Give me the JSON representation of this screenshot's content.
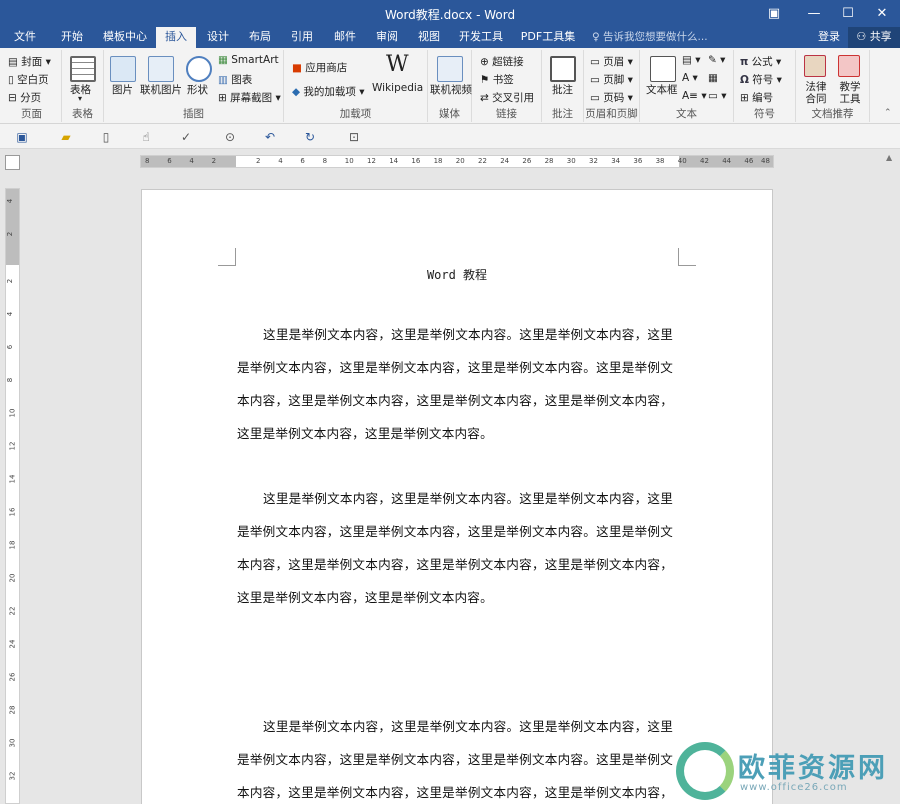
{
  "window": {
    "title": "Word教程.docx - Word",
    "controls": {
      "ribbon_options": "▣",
      "minimize": "—",
      "maximize": "☐",
      "close": "✕"
    }
  },
  "tabs": [
    "文件",
    "开始",
    "模板中心",
    "插入",
    "设计",
    "布局",
    "引用",
    "邮件",
    "审阅",
    "视图",
    "开发工具",
    "PDF工具集"
  ],
  "active_tab": "插入",
  "tell_me": "告诉我您想要做什么...",
  "account": {
    "login": "登录",
    "share": "共享"
  },
  "ribbon": {
    "pages": {
      "label": "页面",
      "cover": "封面",
      "blank": "空白页",
      "break": "分页"
    },
    "tables": {
      "label": "表格",
      "table": "表格"
    },
    "illustrations": {
      "label": "插图",
      "picture": "图片",
      "online_picture": "联机图片",
      "shapes": "形状",
      "smartart": "SmartArt",
      "chart": "图表",
      "screenshot": "屏幕截图"
    },
    "addins": {
      "label": "加载项",
      "store": "应用商店",
      "my_addins": "我的加载项",
      "wikipedia": "Wikipedia"
    },
    "media": {
      "label": "媒体",
      "online_video": "联机视频"
    },
    "links": {
      "label": "链接",
      "hyperlink": "超链接",
      "bookmark": "书签",
      "cross_ref": "交叉引用"
    },
    "comments": {
      "label": "批注",
      "comment": "批注"
    },
    "header_footer": {
      "label": "页眉和页脚",
      "header": "页眉",
      "footer": "页脚",
      "page_number": "页码"
    },
    "text": {
      "label": "文本",
      "textbox": "文本框"
    },
    "symbols": {
      "label": "符号",
      "equation": "公式",
      "symbol": "符号",
      "number": "编号"
    },
    "recommend": {
      "label": "文档推荐",
      "law": "法律合同",
      "teach": "教学工具"
    }
  },
  "ruler": {
    "h_ticks": [
      "8",
      "6",
      "4",
      "2",
      "2",
      "4",
      "6",
      "8",
      "10",
      "12",
      "14",
      "16",
      "18",
      "20",
      "22",
      "24",
      "26",
      "28",
      "30",
      "32",
      "34",
      "36",
      "38",
      "40",
      "42",
      "44",
      "46",
      "48"
    ],
    "v_ticks": [
      "4",
      "2",
      "2",
      "4",
      "6",
      "8",
      "10",
      "12",
      "14",
      "16",
      "18",
      "20",
      "22",
      "24",
      "26",
      "28",
      "30",
      "32"
    ]
  },
  "document": {
    "title": "Word 教程",
    "paragraphs": [
      "这里是举例文本内容，这里是举例文本内容。这里是举例文本内容，这里是举例文本内容，这里是举例文本内容，这里是举例文本内容。这里是举例文本内容，这里是举例文本内容，这里是举例文本内容，这里是举例文本内容，这里是举例文本内容，这里是举例文本内容。",
      "这里是举例文本内容，这里是举例文本内容。这里是举例文本内容，这里是举例文本内容，这里是举例文本内容，这里是举例文本内容。这里是举例文本内容，这里是举例文本内容，这里是举例文本内容，这里是举例文本内容，这里是举例文本内容，这里是举例文本内容。",
      "这里是举例文本内容，这里是举例文本内容。这里是举例文本内容，这里是举例文本内容，这里是举例文本内容，这里是举例文本内容。这里是举例文本内容，这里是举例文本内容，这里是举例文本内容，这里是举例文本内容，这里是举例文本内容，这里是举例文本内容。"
    ]
  },
  "watermark": {
    "name": "欧菲资源网",
    "url": "www.office26.com"
  },
  "colors": {
    "accent": "#2b579a",
    "ribbon_bg": "#f3f3f3",
    "canvas": "#e6e6e6"
  }
}
